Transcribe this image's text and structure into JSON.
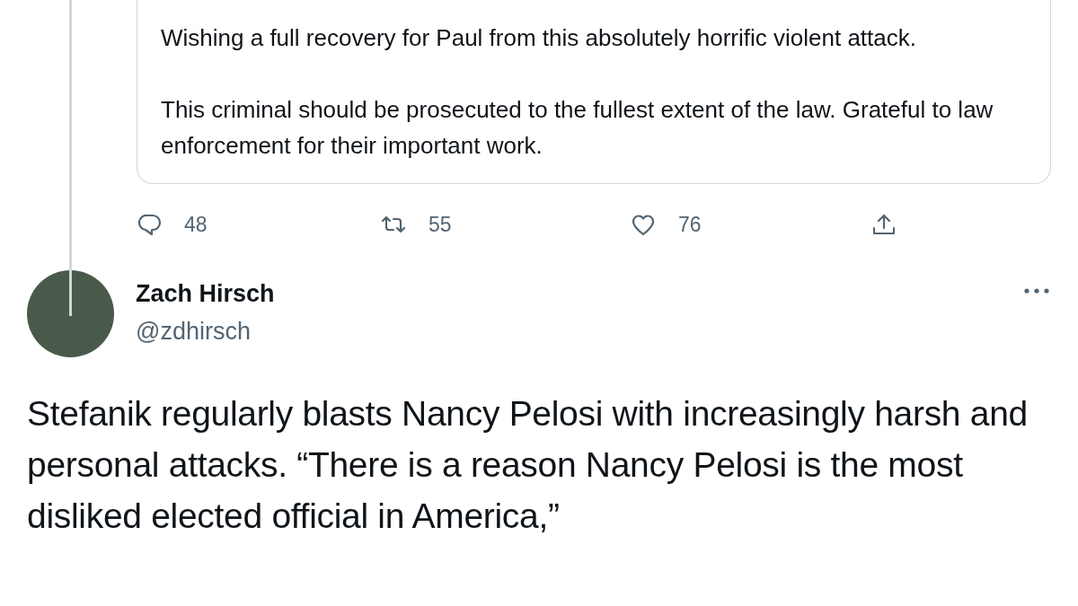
{
  "quoted_tweet": {
    "paragraphs": [
      "Wishing a full recovery for Paul from this absolutely horrific violent attack.",
      "This criminal should be prosecuted to the fullest extent of the law. Grateful to law enforcement for their important work."
    ]
  },
  "actions": [
    {
      "kind": "reply",
      "count": "48"
    },
    {
      "kind": "retweet",
      "count": "55"
    },
    {
      "kind": "like",
      "count": "76"
    },
    {
      "kind": "share"
    }
  ],
  "tweet": {
    "name": "Zach Hirsch",
    "handle": "@zdhirsch",
    "text": "Stefanik regularly blasts Nancy Pelosi with increasingly harsh and personal attacks. “There is a reason Nancy Pelosi is the most disliked elected official in America,”"
  }
}
